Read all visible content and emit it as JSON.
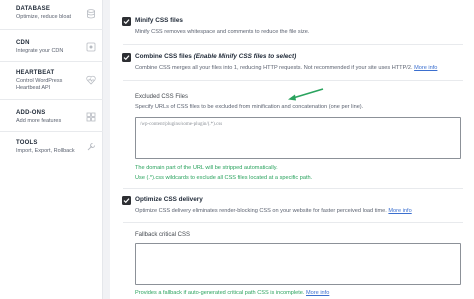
{
  "sidebar": {
    "items": [
      {
        "title": "DATABASE",
        "desc": "Optimize, reduce bloat",
        "icon": "database-icon"
      },
      {
        "title": "CDN",
        "desc": "Integrate your CDN",
        "icon": "cdn-icon"
      },
      {
        "title": "HEARTBEAT",
        "desc": "Control WordPress Heartbeat API",
        "icon": "heartbeat-icon"
      },
      {
        "title": "ADD-ONS",
        "desc": "Add more features",
        "icon": "addons-icon"
      },
      {
        "title": "TOOLS",
        "desc": "Import, Export, Rollback",
        "icon": "tools-icon"
      }
    ]
  },
  "options": {
    "minify": {
      "title": "Minify CSS files",
      "desc": "Minify CSS removes whitespace and comments to reduce the file size."
    },
    "combine": {
      "title_plain": "Combine CSS files",
      "title_em": "(Enable Minify CSS files to select)",
      "desc": "Combine CSS merges all your files into 1, reducing HTTP requests. Not recommended if your site uses HTTP/2.",
      "link": "More info"
    },
    "excluded": {
      "label": "Excluded CSS Files",
      "desc": "Specify URLs of CSS files to be excluded from minification and concatenation (one per line).",
      "placeholder": "/wp-content/plugins/some-plugin/(.*).css",
      "note1": "The domain part of the URL will be stripped automatically.",
      "note2": "Use (.*).css wildcards to exclude all CSS files located at a specific path."
    },
    "optimize": {
      "title": "Optimize CSS delivery",
      "desc": "Optimize CSS delivery eliminates render-blocking CSS on your website for faster perceived load time.",
      "link": "More info"
    },
    "fallback": {
      "label": "Fallback critical CSS",
      "note": "Provides a fallback if auto-generated critical path CSS is incomplete.",
      "link": "More info"
    }
  },
  "colors": {
    "accent_green": "#2aa35e",
    "link_blue": "#3b6fcf",
    "checkbox_dark": "#2d2f33"
  }
}
